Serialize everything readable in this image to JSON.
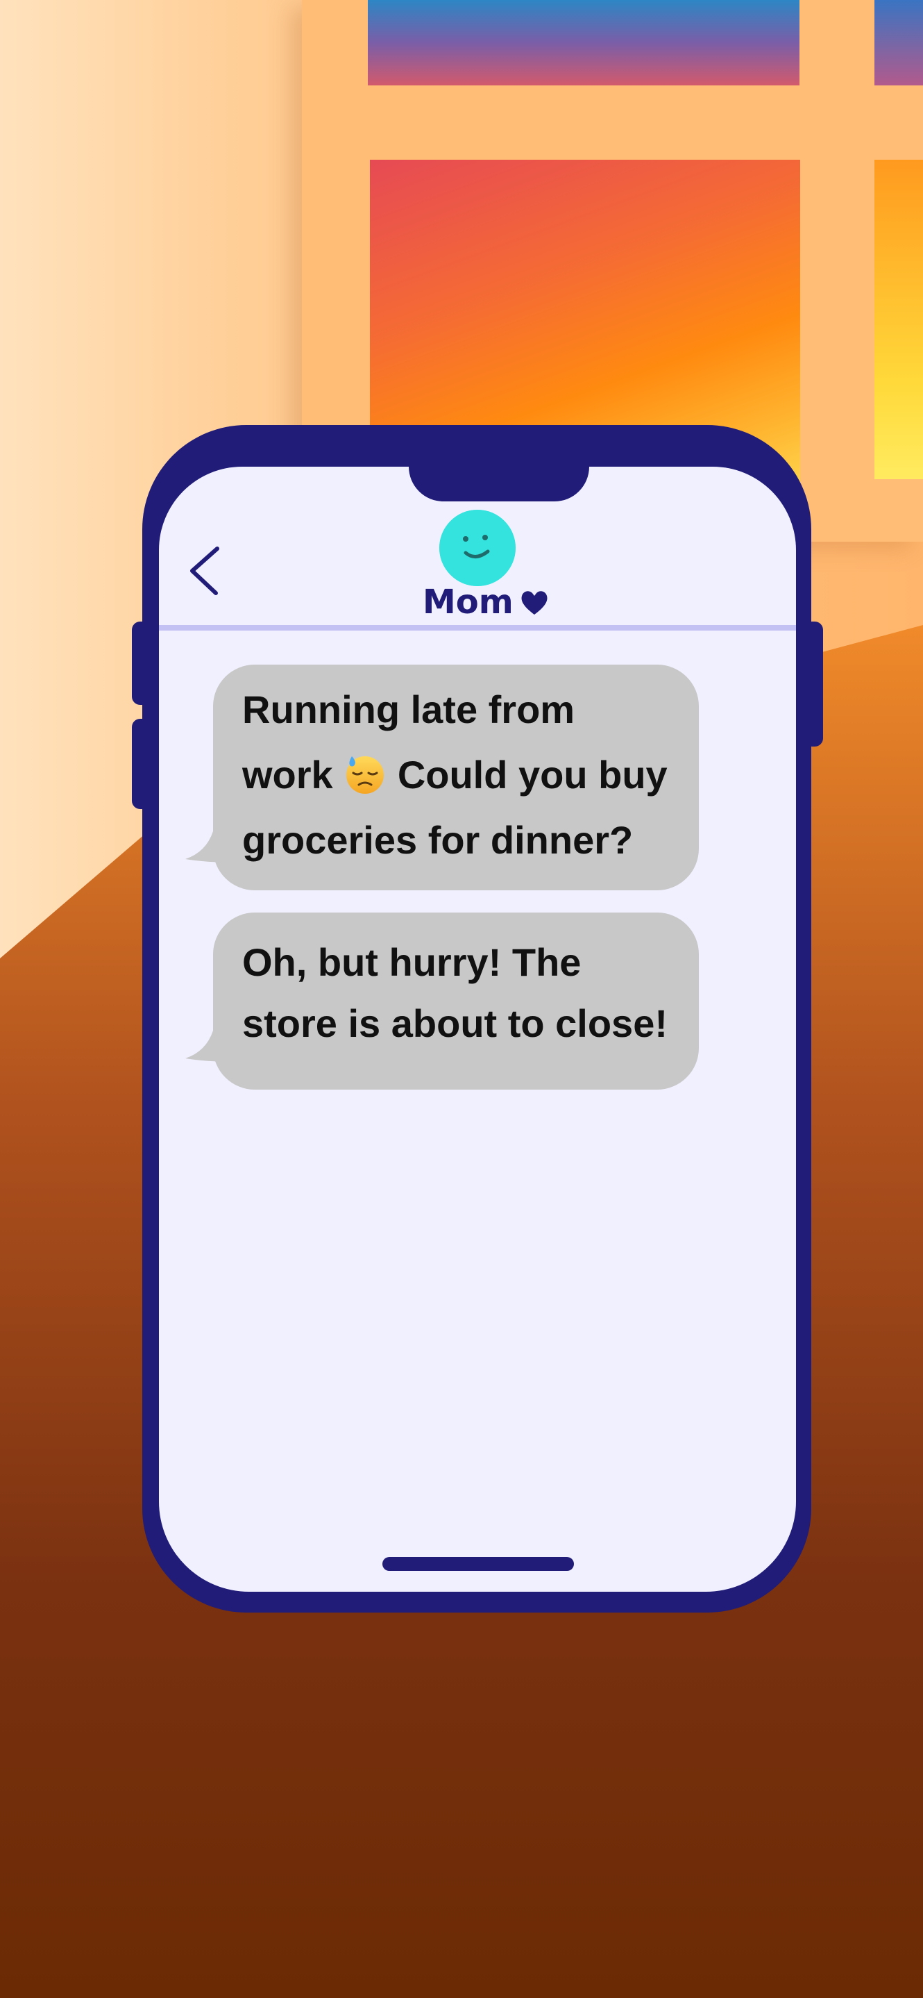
{
  "contact": {
    "name": "Mom"
  },
  "messages": [
    {
      "sender": "Mom",
      "text_before": "Running late from work ",
      "emoji": "downcast-sweat-emoji",
      "text_after": " Could you buy groceries for dinner?"
    },
    {
      "sender": "Mom",
      "text": "Oh, but hurry! The store is about to close!"
    }
  ],
  "icons": {
    "back": "chevron-left-icon",
    "heart": "heart-icon",
    "avatar": "smiley-avatar"
  },
  "colors": {
    "phone_body": "#201c78",
    "screen": "#f1f0ff",
    "bubble": "#c8c8c8",
    "avatar": "#34e3dd",
    "divider": "#c3c0f4"
  }
}
